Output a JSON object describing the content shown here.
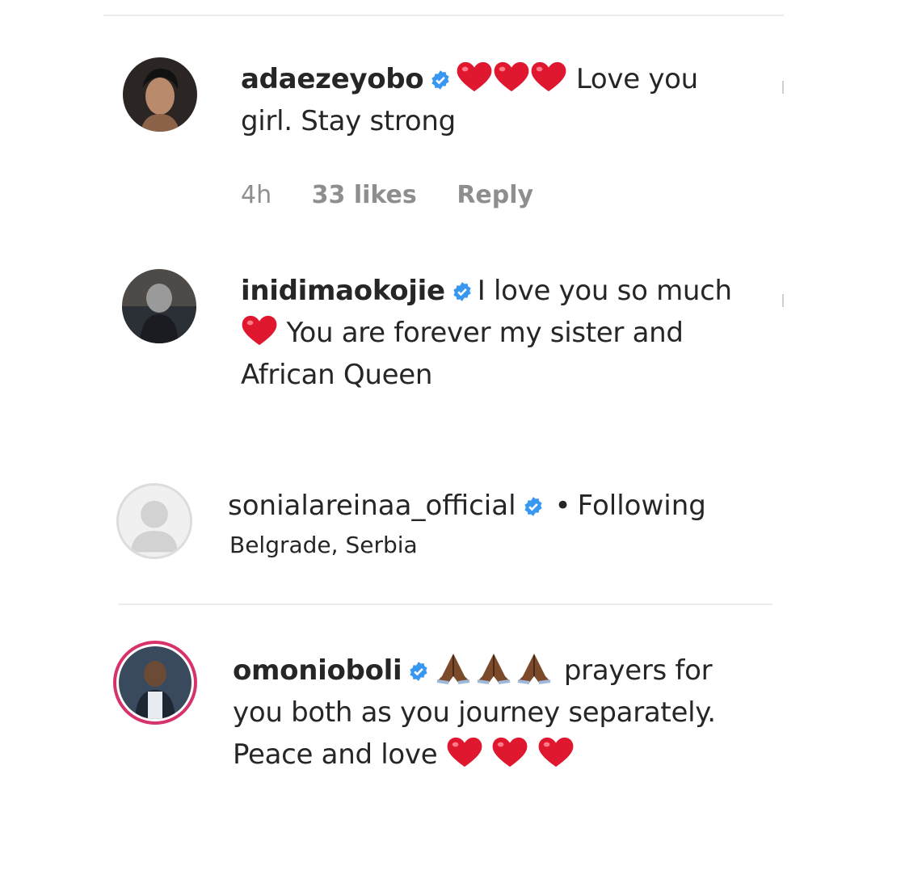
{
  "comments": [
    {
      "username": "adaezeyobo",
      "verified": true,
      "text_after_emojis": " Love you girl. Stay strong",
      "emojis": [
        "heart",
        "heart",
        "heart"
      ],
      "time": "4h",
      "likes": "33 likes",
      "reply_label": "Reply"
    },
    {
      "username": "inidimaokojie",
      "verified": true,
      "text_part1": "I love you so much",
      "text_part2": " You are forever my sister and African Queen",
      "emojis": [
        "heart"
      ]
    },
    {
      "username": "omonioboli",
      "verified": true,
      "emojis_lead": [
        "folded-hands",
        "folded-hands",
        "folded-hands"
      ],
      "text_part1": " prayers for you both as you journey separately. Peace and love ",
      "emojis_end": [
        "heart",
        "heart",
        "heart"
      ]
    }
  ],
  "profile": {
    "username": "sonialareinaa_official",
    "following_label": "Following",
    "location": "Belgrade, Serbia"
  },
  "colors": {
    "verified": "#3897f0",
    "heart": "#e0182f",
    "meta": "#8e8e8e",
    "text": "#262626"
  }
}
